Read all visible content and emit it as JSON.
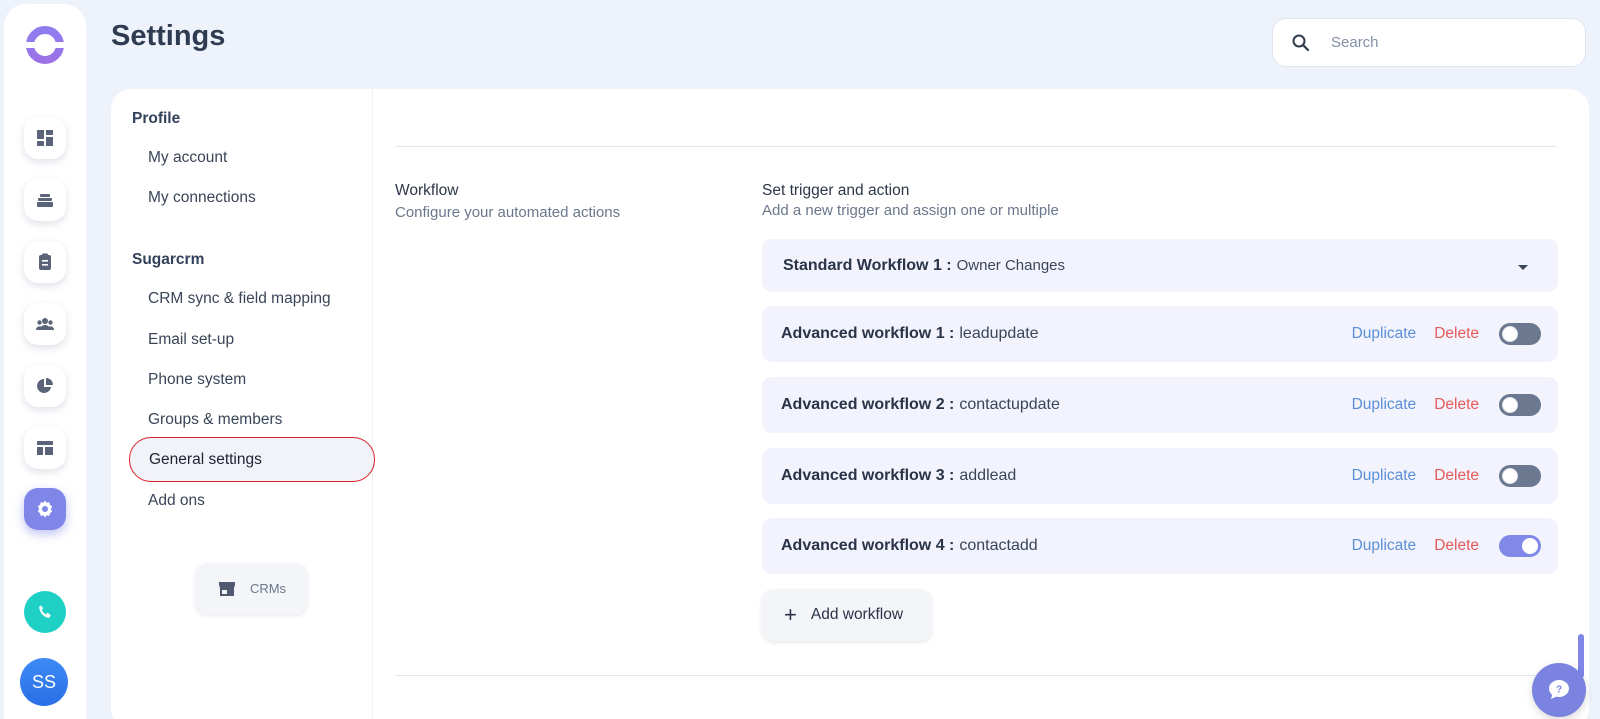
{
  "header": {
    "title": "Settings"
  },
  "search": {
    "placeholder": "Search"
  },
  "rail": {
    "avatar_initials": "SS",
    "icons": [
      "dashboard-icon",
      "inbox-stack-icon",
      "clipboard-icon",
      "people-icon",
      "pie-chart-icon",
      "layout-icon",
      "gear-icon",
      "phone-icon"
    ]
  },
  "nav": {
    "groups": [
      {
        "label": "Profile",
        "items": [
          "My account",
          "My connections"
        ]
      },
      {
        "label": "Sugarcrm",
        "items": [
          "CRM sync & field mapping",
          "Email set-up",
          "Phone system",
          "Groups & members",
          "General settings",
          "Add ons"
        ]
      }
    ],
    "active_item": "General settings",
    "crms_label": "CRMs"
  },
  "workflow_section": {
    "title": "Workflow",
    "subtitle": "Configure your automated actions",
    "panel_title": "Set trigger and action",
    "panel_subtitle": "Add a new trigger and assign one or multiple",
    "standard": {
      "label": "Standard Workflow 1 :",
      "value": "Owner Changes"
    },
    "advanced": [
      {
        "label": "Advanced workflow 1 :",
        "value": "leadupdate",
        "enabled": false
      },
      {
        "label": "Advanced workflow 2 :",
        "value": "contactupdate",
        "enabled": false
      },
      {
        "label": "Advanced workflow 3 :",
        "value": "addlead",
        "enabled": false
      },
      {
        "label": "Advanced workflow 4 :",
        "value": "contactadd",
        "enabled": true
      }
    ],
    "duplicate_label": "Duplicate",
    "delete_label": "Delete",
    "add_label": "Add workflow"
  },
  "colors": {
    "accent": "#7f86e8",
    "delete": "#e45a5a",
    "link": "#5b8fd6",
    "highlight_border": "#d8202a"
  }
}
